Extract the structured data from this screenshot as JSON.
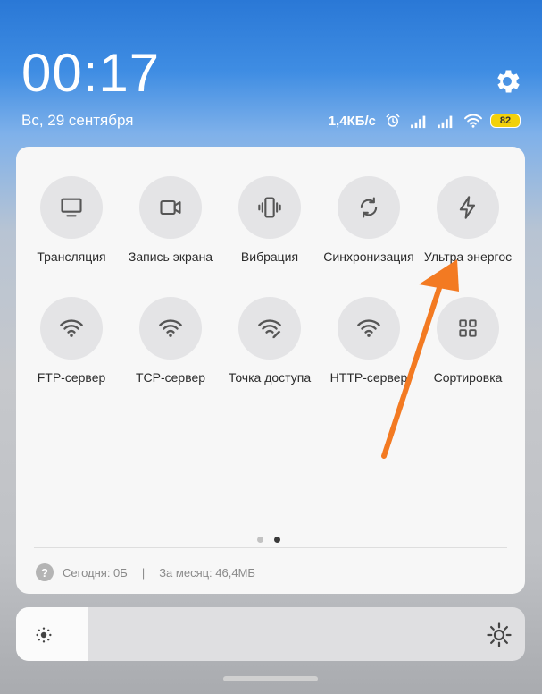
{
  "status_bar": {
    "time": "00:17",
    "date": "Вс, 29 сентября",
    "network_speed": "1,4КБ/с",
    "battery_level": "82",
    "icons": [
      "alarm-icon",
      "signal-icon",
      "signal-icon",
      "wifi-icon",
      "battery-icon",
      "settings-gear-icon"
    ]
  },
  "quick_tiles": [
    {
      "label": "Трансляция",
      "icon": "monitor-icon"
    },
    {
      "label": "Запись экрана",
      "icon": "video-camera-icon"
    },
    {
      "label": "Вибрация",
      "icon": "vibration-icon"
    },
    {
      "label": "Синхронизация",
      "icon": "sync-icon"
    },
    {
      "label": "Ультра энергос",
      "icon": "lightning-icon"
    },
    {
      "label": "FTP-сервер",
      "icon": "wifi-icon"
    },
    {
      "label": "TCP-сервер",
      "icon": "wifi-icon"
    },
    {
      "label": "Точка доступа",
      "icon": "hotspot-edit-icon"
    },
    {
      "label": "HTTP-сервер",
      "icon": "wifi-icon"
    },
    {
      "label": "Сортировка",
      "icon": "grid-icon"
    }
  ],
  "pager": {
    "pages": 2,
    "active": 2
  },
  "data_usage": {
    "today": "Сегодня: 0Б",
    "separator": "|",
    "month": "За месяц: 46,4МБ"
  },
  "brightness": {
    "level": 0.14
  },
  "colors": {
    "annotation_arrow": "#f37a22",
    "battery": "#f2d10c"
  }
}
